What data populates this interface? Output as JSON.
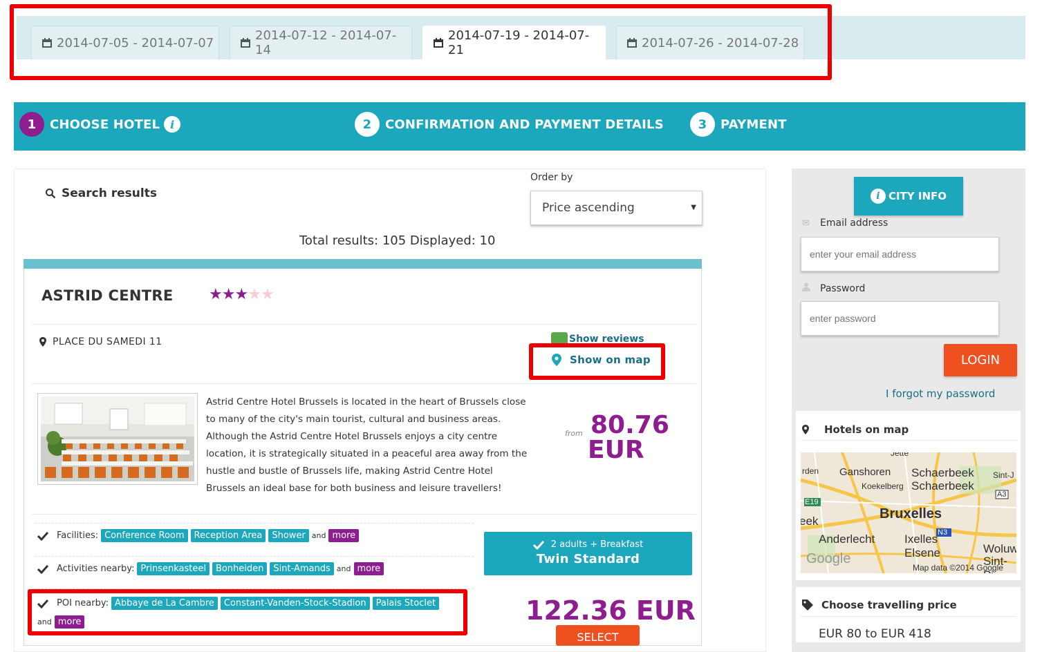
{
  "date_tabs": [
    {
      "label": "2014-07-05 - 2014-07-07",
      "active": false
    },
    {
      "label": "2014-07-12 - 2014-07-14",
      "active": false
    },
    {
      "label": "2014-07-19 - 2014-07-21",
      "active": true
    },
    {
      "label": "2014-07-26 - 2014-07-28",
      "active": false
    }
  ],
  "steps": [
    {
      "number": "1",
      "label": "CHOOSE HOTEL",
      "active": true
    },
    {
      "number": "2",
      "label": "CONFIRMATION AND PAYMENT DETAILS",
      "active": false
    },
    {
      "number": "3",
      "label": "PAYMENT",
      "active": false
    }
  ],
  "info_glyph": "i",
  "search": {
    "title": "Search results",
    "order_by_label": "Order by",
    "order_by_value": "Price ascending",
    "totals": "Total results: 105 Displayed: 10"
  },
  "hotel": {
    "name": "ASTRID CENTRE",
    "stars_filled": 3,
    "stars_total": 5,
    "address": "PLACE DU SAMEDI 11",
    "show_reviews": "Show reviews",
    "show_on_map": "Show on map",
    "description": "Astrid Centre Hotel Brussels is located in the heart of Brussels close to many of the city's main tourist, cultural and business areas. Although the Astrid Centre Hotel Brussels enjoys a city centre location, it is strategically situated in a peaceful area away from the hustle and bustle of Brussels life, making Astrid Centre Hotel Brussels an ideal base for both business and leisure travellers!",
    "from_label": "from",
    "price_amount": "80.76",
    "price_currency": "EUR",
    "and_label": "and",
    "more_label": "more",
    "facilities_label": "Facilities:",
    "facilities": [
      "Conference Room",
      "Reception Area",
      "Shower"
    ],
    "activities_label": "Activities nearby:",
    "activities": [
      "Prinsenkasteel",
      "Bonheiden",
      "Sint-Amands"
    ],
    "poi_label": "POI nearby:",
    "poi": [
      "Abbaye de La Cambre",
      "Constant-Vanden-Stock-Stadion",
      "Palais Stoclet"
    ],
    "room_occupancy": "2 adults + Breakfast",
    "room_type": "Twin Standard",
    "room_price": "122.36 EUR",
    "select_label": "SELECT"
  },
  "sidebar": {
    "city_info": "CITY INFO",
    "email_label": "Email address",
    "email_placeholder": "enter your email address",
    "password_label": "Password",
    "password_placeholder": "enter password",
    "login_label": "LOGIN",
    "forgot_label": "I forgot my password",
    "hotels_on_map": "Hotels on map",
    "map_labels": {
      "ganshoren": "Ganshoren",
      "schaerbeek1": "Schaerbeek",
      "schaerbeek2": "Schaerbeek",
      "koekelberg": "Koekelberg",
      "bruxelles": "Bruxelles",
      "anderlecht": "Anderlecht",
      "ixelles": "Ixelles",
      "elsene": "Elsene",
      "rden": "rden",
      "eek": "eek",
      "sintj": "Sint-J",
      "woluw": "Woluw",
      "sintpi": "Sint-Pi",
      "jette": "Jette",
      "e19": "E19",
      "a3": "A3",
      "n3": "N3",
      "google": "Google",
      "map_data": "Map data ©2014 Google"
    },
    "travelling_price_title": "Choose travelling price",
    "price_range": "EUR 80 to EUR 418"
  },
  "colors": {
    "accent": "#1ca7bd",
    "brand_purple": "#8e1e8f",
    "orange": "#ee5020",
    "highlight_red": "#ee0000"
  }
}
